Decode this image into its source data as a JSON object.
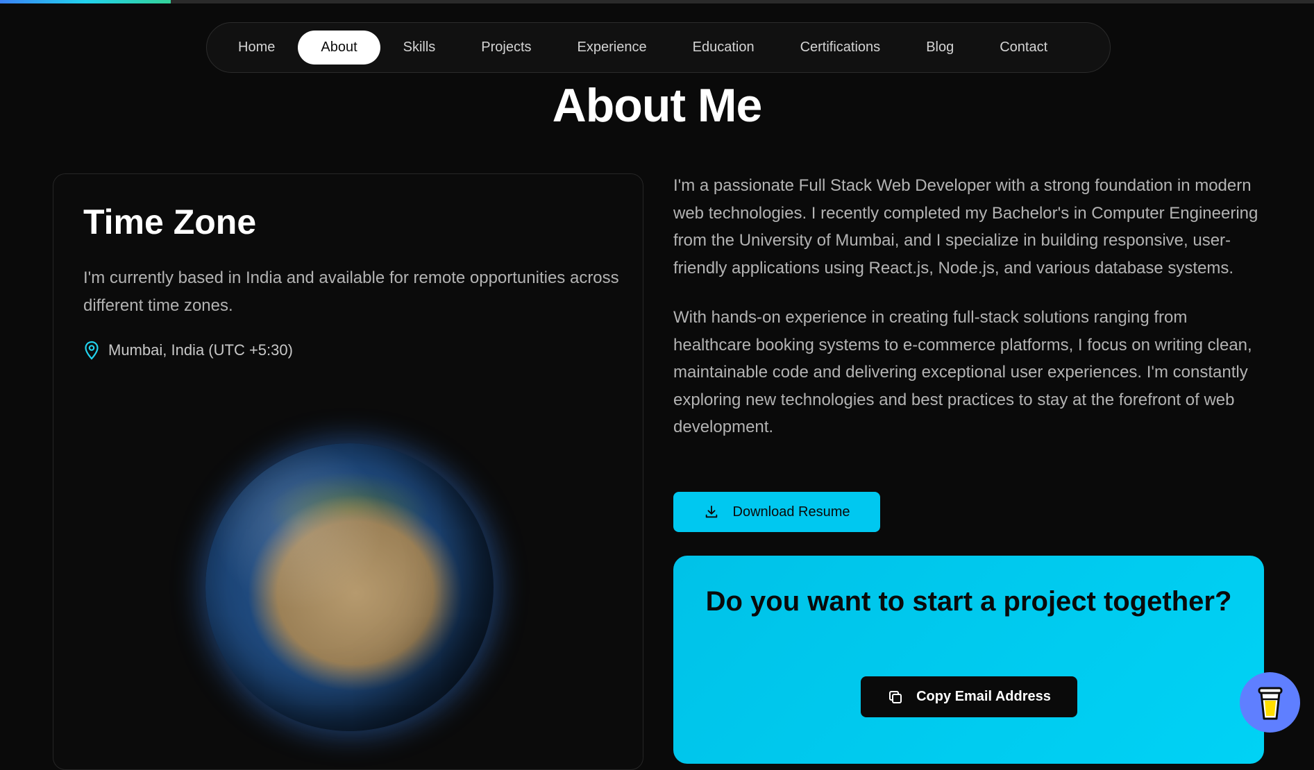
{
  "scroll_progress": {
    "fraction": 0.13,
    "colors": [
      "#3b82f6",
      "#22d3ee",
      "#34d399"
    ]
  },
  "nav": {
    "items": [
      {
        "label": "Home",
        "active": false
      },
      {
        "label": "About",
        "active": true
      },
      {
        "label": "Skills",
        "active": false
      },
      {
        "label": "Projects",
        "active": false
      },
      {
        "label": "Experience",
        "active": false
      },
      {
        "label": "Education",
        "active": false
      },
      {
        "label": "Certifications",
        "active": false
      },
      {
        "label": "Blog",
        "active": false
      },
      {
        "label": "Contact",
        "active": false
      }
    ]
  },
  "page": {
    "title": "About Me"
  },
  "timezone_card": {
    "title": "Time Zone",
    "description": "I'm currently based in India and available for remote opportunities across different time zones.",
    "location": "Mumbai, India (UTC +5:30)",
    "location_icon": "map-pin-icon",
    "globe_icon": "earth-globe"
  },
  "about": {
    "paragraphs": [
      "I'm a passionate Full Stack Web Developer with a strong foundation in modern web technologies. I recently completed my Bachelor's in Computer Engineering from the University of Mumbai, and I specialize in building responsive, user-friendly applications using React.js, Node.js, and various database systems.",
      "With hands-on experience in creating full-stack solutions ranging from healthcare booking systems to e-commerce platforms, I focus on writing clean, maintainable code and delivering exceptional user experiences. I'm constantly exploring new technologies and best practices to stay at the forefront of web development."
    ],
    "download_label": "Download Resume",
    "download_icon": "download-icon"
  },
  "cta": {
    "title": "Do you want to start a project together?",
    "copy_label": "Copy Email Address",
    "copy_icon": "copy-icon"
  },
  "floating": {
    "icon": "coffee-cup-icon"
  },
  "colors": {
    "background": "#0a0a0a",
    "accent": "#00c8f0",
    "text_muted": "#b3b3b3",
    "floating_button": "#5f7fff"
  }
}
